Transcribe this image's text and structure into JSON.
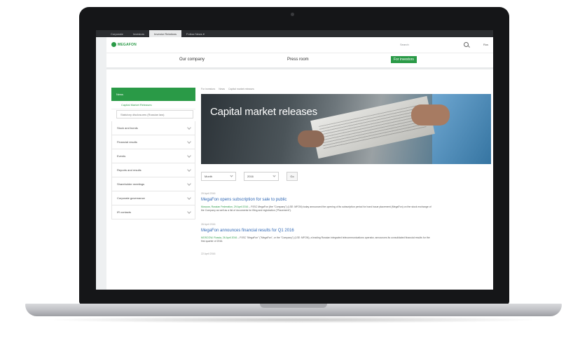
{
  "browser": {
    "tabs": [
      {
        "label": "Corporate",
        "active": false
      },
      {
        "label": "Investors",
        "active": false
      },
      {
        "label": "Investor Relations",
        "active": true
      },
      {
        "label": "Follow News ▾",
        "active": false
      }
    ]
  },
  "header": {
    "logo_text": "MEGAFON",
    "search_label": "Search",
    "lang": "Rus"
  },
  "nav": {
    "items": [
      "Our company",
      "Press room",
      "For investors"
    ],
    "active": "For investors"
  },
  "sidebar": {
    "active_label": "News",
    "sub_items": [
      {
        "label": "Capital Market Releases",
        "style": "green"
      },
      {
        "label": "Statutory disclosures (Russian law)",
        "style": "gray"
      }
    ],
    "items": [
      "Stock and bonds",
      "Financial results",
      "Events",
      "Reports and results",
      "Shareholder meetings",
      "Corporate governance",
      "IR contacts"
    ]
  },
  "main": {
    "breadcrumb": [
      "For investors",
      "News",
      "Capital market releases"
    ],
    "hero_title": "Capital market releases",
    "filters": {
      "month": "Month",
      "year": "2016",
      "button": "Go"
    },
    "releases": [
      {
        "date": "29 April 2016",
        "title": "MegaFon opens subscription for sale to public",
        "source": "Moscow, Russian Federation, 29 April 2016",
        "body": " – PJSC MegaFon (the \"Company\") (LSE: MFON) today announced the opening of its subscription period for bond issue placement (MegaFon) on the stock exchange of the Company as well as a list of documents for filing and registration (\"Placement\")."
      },
      {
        "date": "26 April 2016",
        "title": "MegaFon announces financial results for Q1 2016",
        "source": "MOSCOW, Russia, 26 April 2016",
        "body": " – PJSC \"MegaFon\" (\"MegaFon\", or the \"Company\") (LSE: MFON), a leading Russian integrated telecommunications operator, announces its consolidated financial results for the first quarter of 2016."
      }
    ],
    "next_date": "22 April 2016"
  }
}
